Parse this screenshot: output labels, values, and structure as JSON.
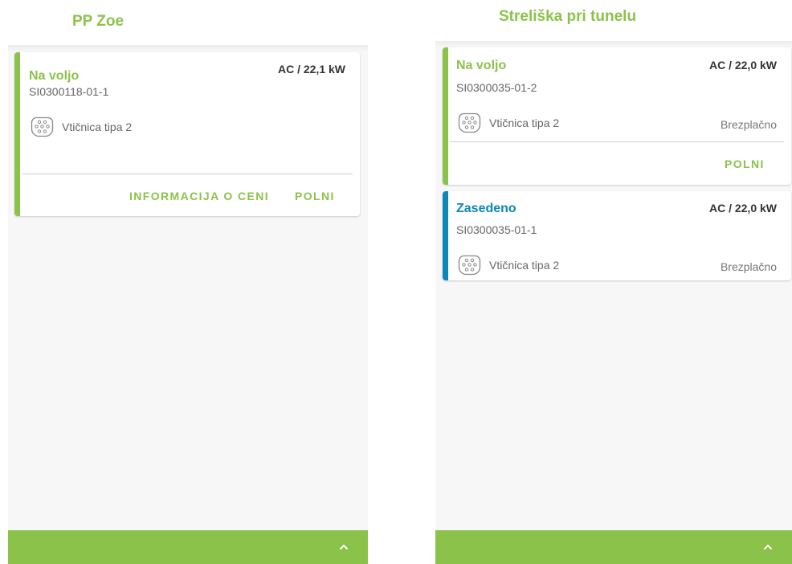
{
  "colors": {
    "accent": "#8bc34a",
    "available": "#8bc34a",
    "occupied": "#0e86b8",
    "bottom_bar": "#8bc34a"
  },
  "left": {
    "station_title": "PP Zoe",
    "card": {
      "status": "Na voljo",
      "power": "AC / 22,1 kW",
      "code": "SI0300118-01-1",
      "connector_icon": "type2-connector-icon",
      "connector_label": "Vtičnica tipa 2",
      "actions": {
        "price_info": "INFORMACIJA O CENI",
        "charge": "POLNI"
      }
    },
    "bottom_bar": {
      "icon": "chevron-up-icon"
    }
  },
  "right": {
    "station_title": "Streliška pri tunelu",
    "cards": [
      {
        "status": "Na voljo",
        "power": "AC / 22,0 kW",
        "code": "SI0300035-01-2",
        "connector_icon": "type2-connector-icon",
        "connector_label": "Vtičnica tipa 2",
        "price": "Brezplačno",
        "action_charge": "POLNI"
      },
      {
        "status": "Zasedeno",
        "power": "AC / 22,0 kW",
        "code": "SI0300035-01-1",
        "connector_icon": "type2-connector-icon",
        "connector_label": "Vtičnica tipa 2",
        "price": "Brezplačno"
      }
    ],
    "bottom_bar": {
      "icon": "chevron-up-icon"
    }
  }
}
